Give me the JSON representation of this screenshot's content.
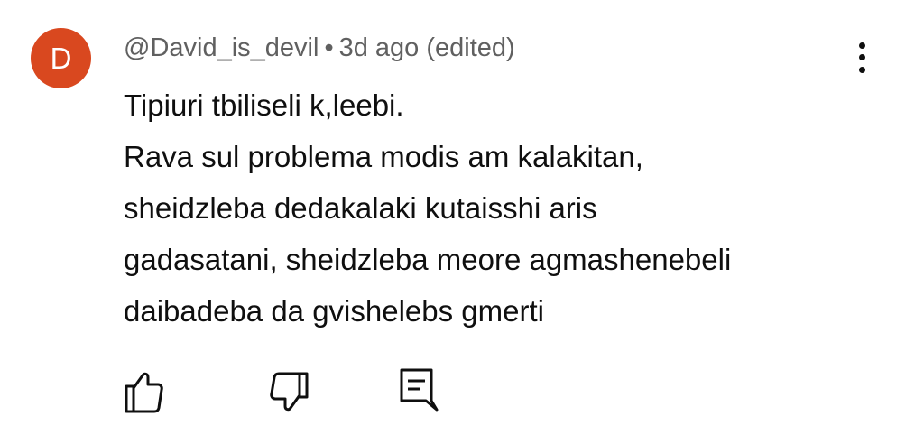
{
  "comment": {
    "avatar_letter": "D",
    "avatar_color": "#d9481f",
    "author": "@David_is_devil",
    "separator": "•",
    "time": "3d ago",
    "edited": "(edited)",
    "text_lines": [
      "Tipiuri tbiliseli k,leebi.",
      "Rava sul problema modis am kalakitan,",
      "sheidzleba dedakalaki kutaisshi aris",
      "gadasatani, sheidzleba meore agmashenebeli",
      "daibadeba da gvishelebs gmerti"
    ]
  },
  "actions": [
    {
      "icon": "thumb-up-icon"
    },
    {
      "icon": "thumb-down-icon"
    },
    {
      "icon": "reply-comment-icon"
    }
  ],
  "menu": {
    "icon": "more-vertical-icon"
  }
}
